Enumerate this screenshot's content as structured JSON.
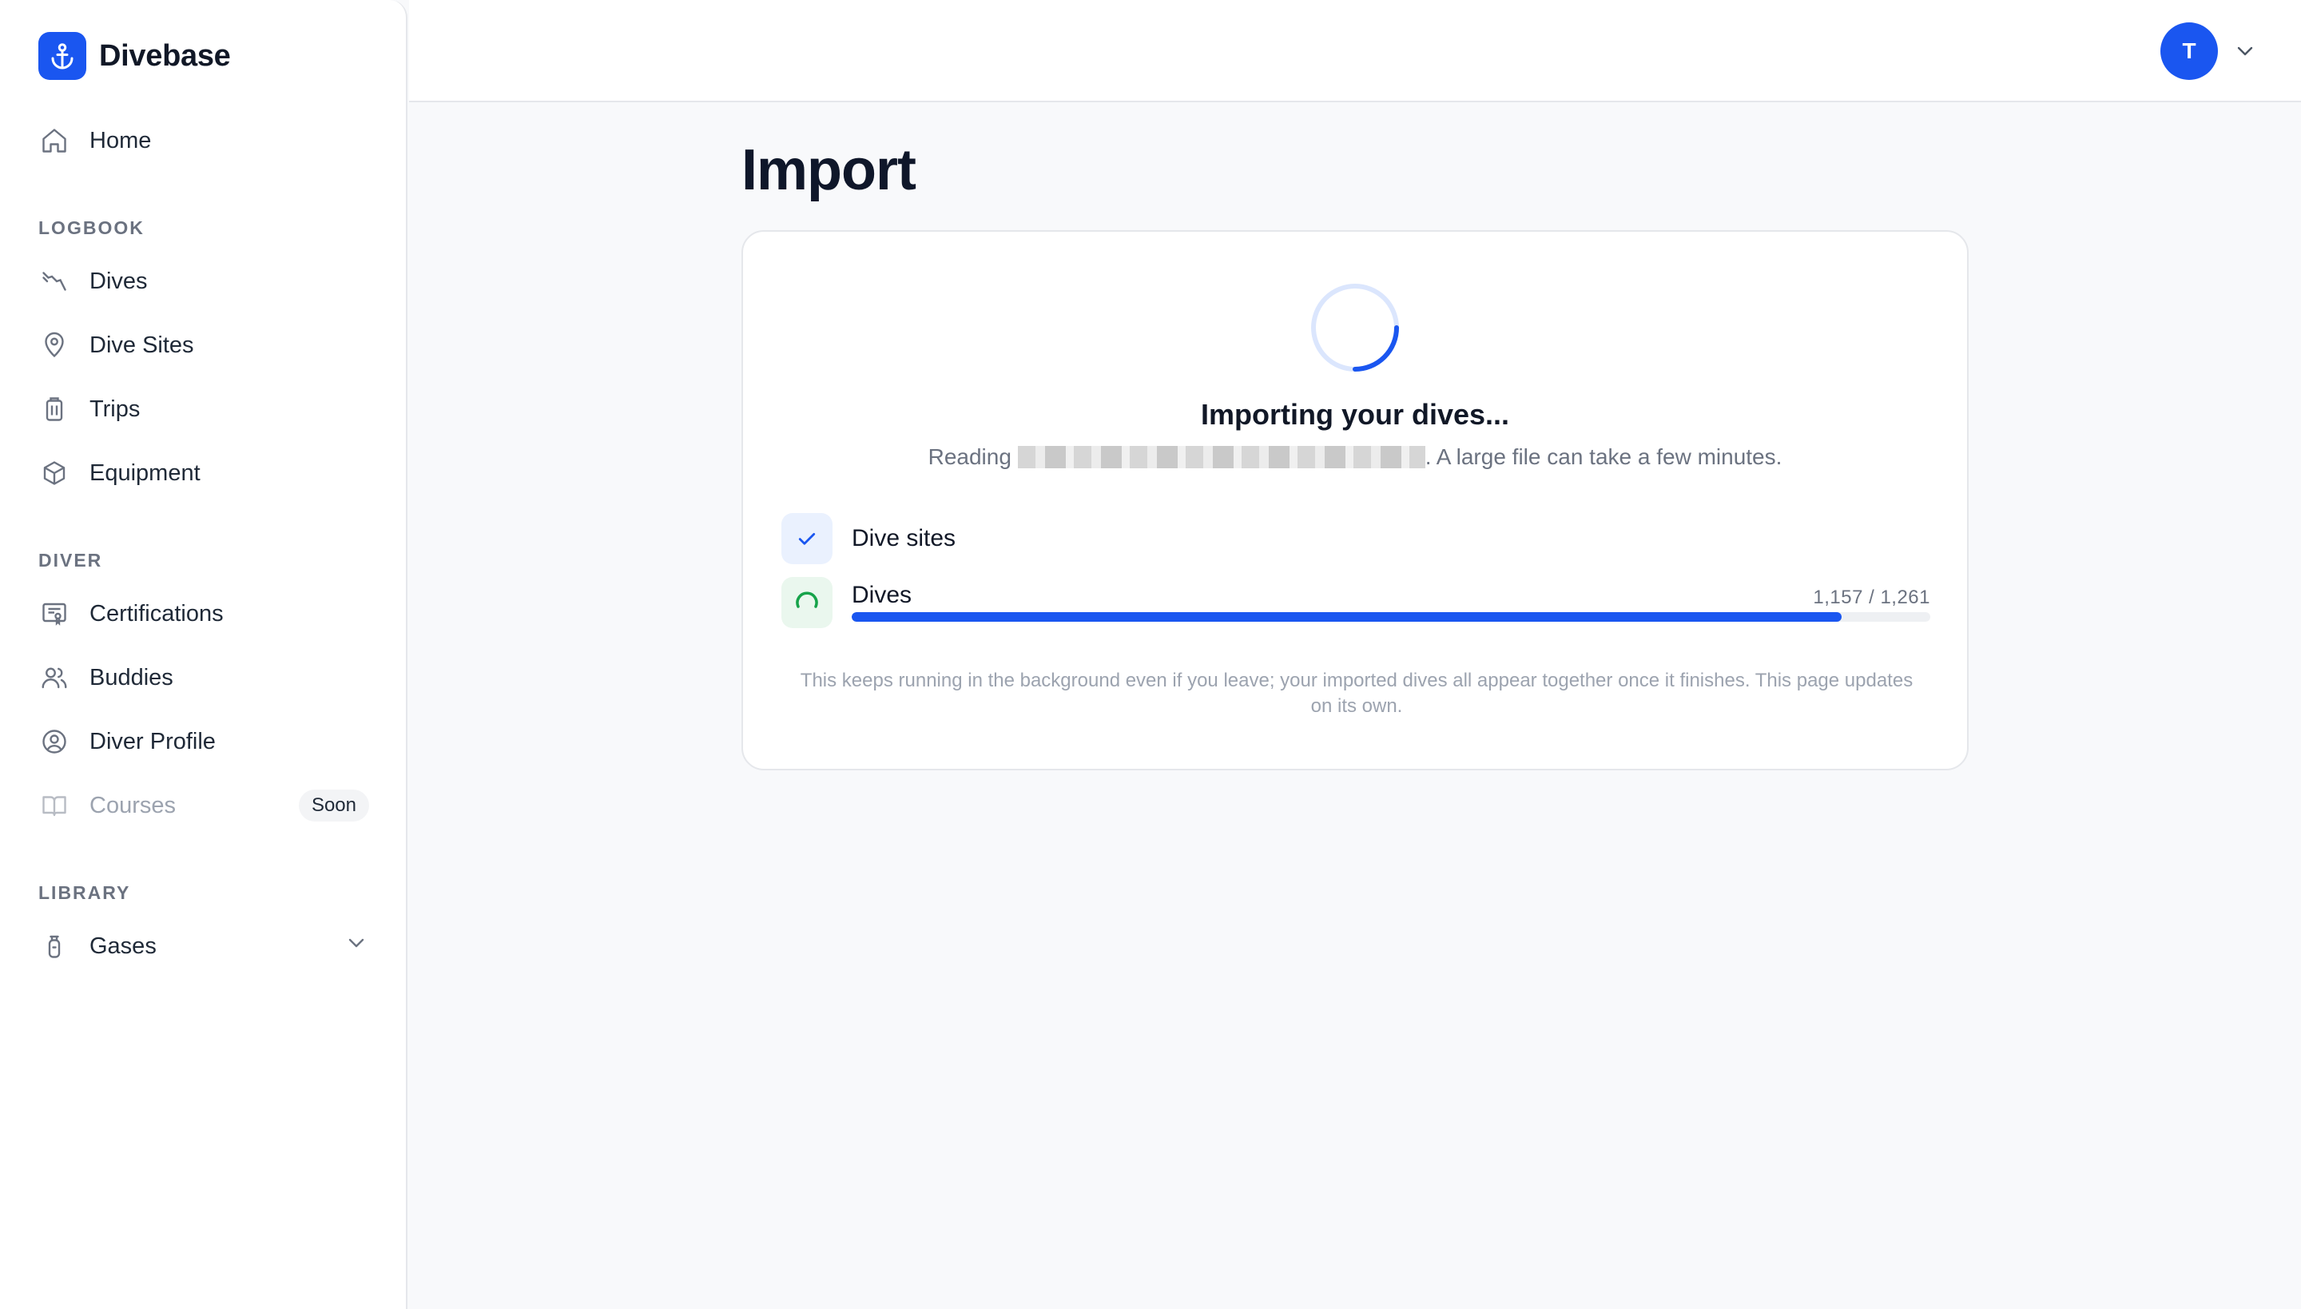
{
  "brand": {
    "name": "Divebase",
    "logo_icon": "anchor-icon",
    "accent": "#1a56f0"
  },
  "sidebar": {
    "home": {
      "label": "Home",
      "icon": "home-icon"
    },
    "sections": [
      {
        "label": "LOGBOOK"
      },
      {
        "label": "DIVER"
      },
      {
        "label": "LIBRARY"
      }
    ],
    "logbook": [
      {
        "label": "Dives",
        "icon": "dive-icon"
      },
      {
        "label": "Dive Sites",
        "icon": "map-pin-icon"
      },
      {
        "label": "Trips",
        "icon": "luggage-icon"
      },
      {
        "label": "Equipment",
        "icon": "box-icon"
      }
    ],
    "diver": [
      {
        "label": "Certifications",
        "icon": "certificate-icon"
      },
      {
        "label": "Buddies",
        "icon": "users-icon"
      },
      {
        "label": "Diver Profile",
        "icon": "user-circle-icon"
      },
      {
        "label": "Courses",
        "icon": "book-icon",
        "badge": "Soon"
      }
    ],
    "library": [
      {
        "label": "Gases",
        "icon": "gas-cylinder-icon"
      }
    ]
  },
  "header": {
    "avatar_initial": "T"
  },
  "page": {
    "title": "Import"
  },
  "import": {
    "title": "Importing your dives...",
    "sub_prefix": "Reading",
    "sub_suffix": ". A large file can take a few minutes.",
    "steps": [
      {
        "label": "Dive sites",
        "status": "done"
      },
      {
        "label": "Dives",
        "status": "running",
        "count": "1,157 / 1,261",
        "progress": 0.918
      }
    ],
    "footnote": "This keeps running in the background even if you leave; your imported dives all appear together once it finishes. This page updates on its own."
  }
}
